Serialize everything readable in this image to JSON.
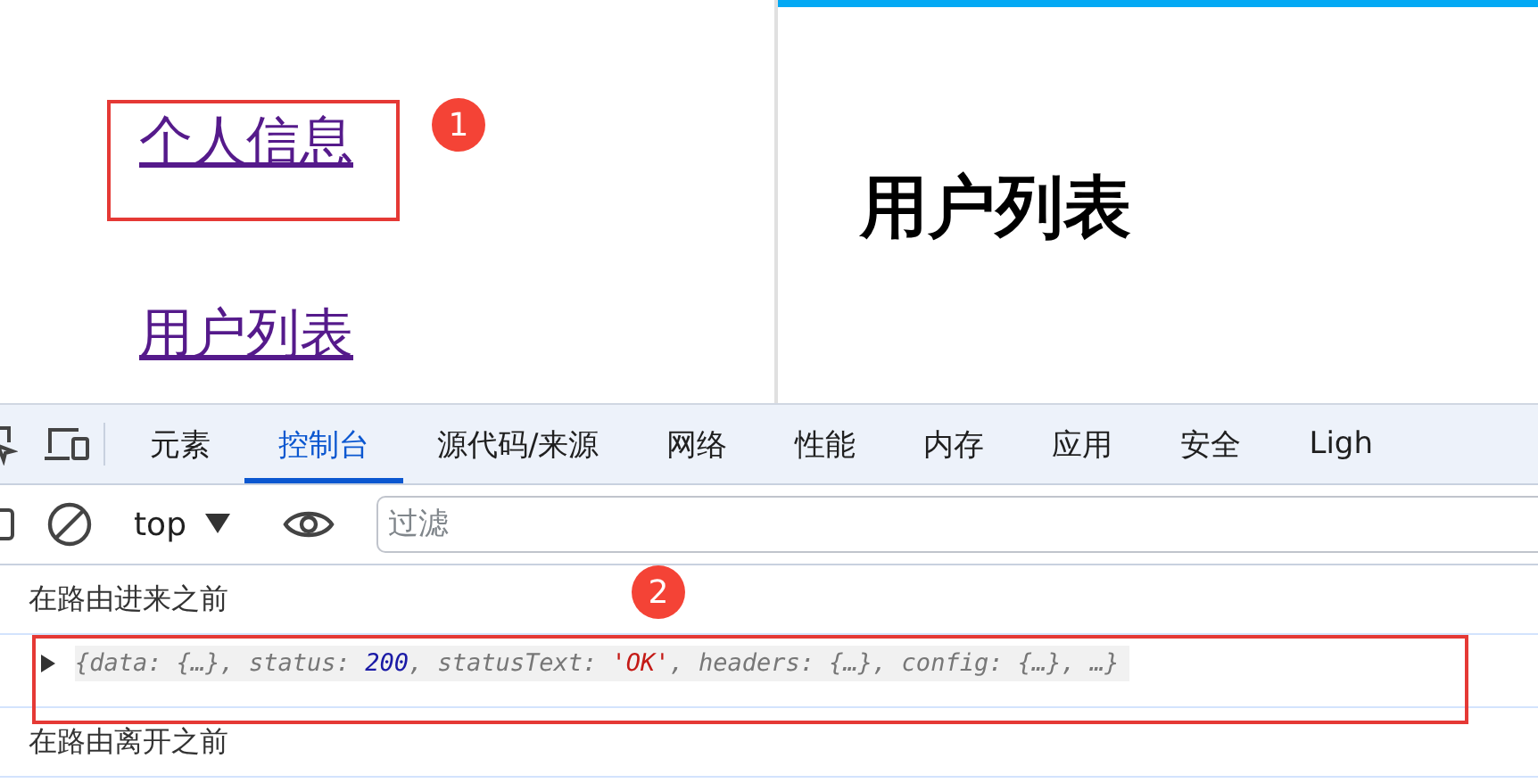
{
  "nav_links": [
    {
      "label": "个人信息"
    },
    {
      "label": "用户列表"
    }
  ],
  "page_heading": "用户列表",
  "annotations": [
    {
      "number": "1"
    },
    {
      "number": "2"
    }
  ],
  "devtools": {
    "tabs": [
      {
        "label": "元素",
        "selected": false
      },
      {
        "label": "控制台",
        "selected": true
      },
      {
        "label": "源代码/来源",
        "selected": false
      },
      {
        "label": "网络",
        "selected": false
      },
      {
        "label": "性能",
        "selected": false
      },
      {
        "label": "内存",
        "selected": false
      },
      {
        "label": "应用",
        "selected": false
      },
      {
        "label": "安全",
        "selected": false
      },
      {
        "label": "Ligh",
        "selected": false
      }
    ],
    "context": "top",
    "filter": {
      "placeholder": "过滤"
    },
    "console": [
      {
        "kind": "log",
        "text": "在路由进来之前"
      },
      {
        "kind": "object",
        "expanded": false,
        "tokens": [
          {
            "kind": "text",
            "text": "{data: {…}, status: "
          },
          {
            "kind": "number",
            "text": "200"
          },
          {
            "kind": "text",
            "text": ", statusText: "
          },
          {
            "kind": "string",
            "text": "'OK'"
          },
          {
            "kind": "text",
            "text": ", headers: {…}, config: {…},  …}"
          }
        ]
      },
      {
        "kind": "log",
        "text": "在路由离开之前"
      }
    ]
  }
}
